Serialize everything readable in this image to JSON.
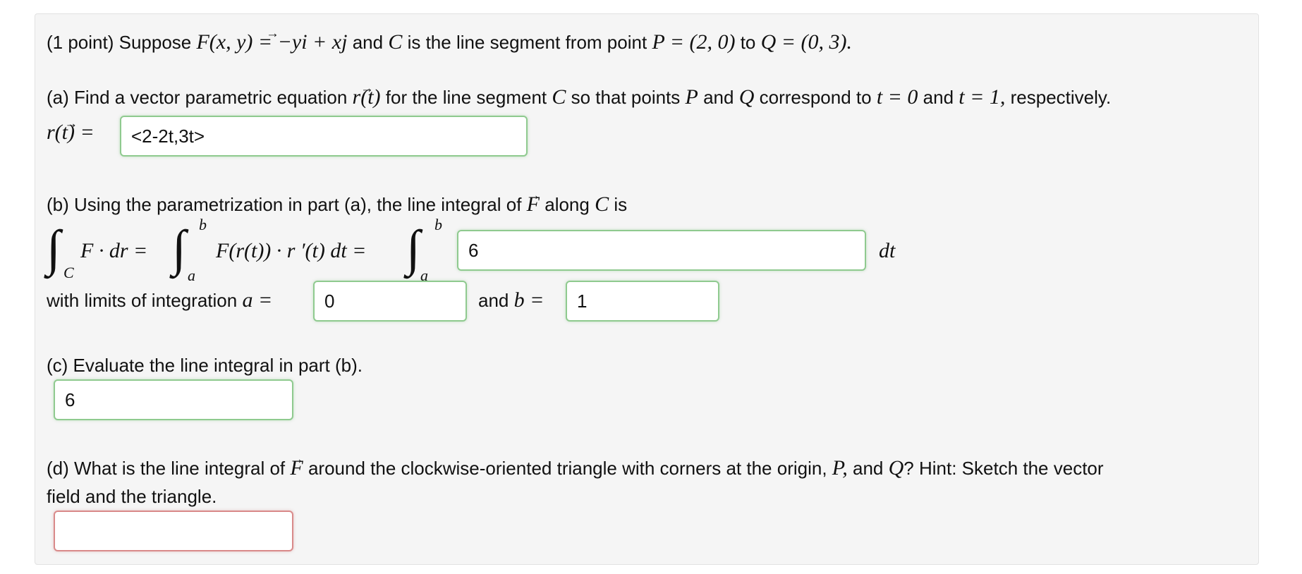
{
  "header": {
    "points": "(1 point) Suppose",
    "f_def": "F(x, y) = −yi + xj",
    "and_c": "and",
    "c_sym": "C",
    "segment_text": "is the line segment from point",
    "p_def": "P = (2, 0)",
    "to": "to",
    "q_def": "Q = (0, 3)."
  },
  "part_a": {
    "prefix": "(a) Find a vector parametric equation",
    "r_of_t": "r(t)",
    "text1": "for the line segment",
    "c_sym": "C",
    "text2": "so that points",
    "p_sym": "P",
    "and": "and",
    "q_sym": "Q",
    "text3": "correspond to",
    "t0": "t = 0",
    "and2": "and",
    "t1": "t = 1,",
    "suffix": "respectively.",
    "label": "r(t) =",
    "answer": "<2-2t,3t>"
  },
  "part_b": {
    "prefix": "(b) Using the parametrization in part (a), the line integral of",
    "f_sym": "F",
    "along": "along",
    "c_sym": "C",
    "is": "is",
    "integrand1": "F · dr =",
    "sub_c": "C",
    "lim_b": "b",
    "lim_a": "a",
    "integrand2": "F(r(t)) · r ′(t) dt =",
    "answer_integrand": "6",
    "dt": "dt",
    "limits_text": "with limits of integration",
    "a_eq": "a =",
    "answer_a": "0",
    "and_b": "and",
    "b_eq": "b =",
    "answer_b": "1"
  },
  "part_c": {
    "question": "(c) Evaluate the line integral in part (b).",
    "answer": "6"
  },
  "part_d": {
    "prefix": "(d) What is the line integral of",
    "f_sym": "F",
    "text1": "around the clockwise-oriented triangle with corners at the origin,",
    "p_sym": "P,",
    "and": "and",
    "q_sym": "Q",
    "text2": "? Hint: Sketch the vector",
    "line2": "field and the triangle.",
    "answer": ""
  },
  "colors": {
    "correct_border": "#8fca8f",
    "incorrect_border": "#d98a8a",
    "panel_bg": "#f5f5f5"
  }
}
